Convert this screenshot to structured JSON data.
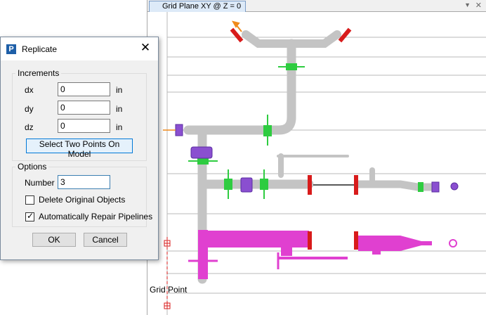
{
  "model_window": {
    "tab_title": "Grid Plane XY @ Z = 0",
    "grid_point_label": "Grid Point",
    "colors": {
      "pipe_gray": "#c8c8c8",
      "pipe_selected": "#e040d0",
      "flange_red": "#d81b1b",
      "support_green": "#2ecc40",
      "valve_purple": "#8a4fd0",
      "grid_line": "#b8b8b8"
    }
  },
  "dialog": {
    "title": "Replicate",
    "increments": {
      "legend": "Increments",
      "dx_label": "dx",
      "dx_value": "0",
      "dx_unit": "in",
      "dy_label": "dy",
      "dy_value": "0",
      "dy_unit": "in",
      "dz_label": "dz",
      "dz_value": "0",
      "dz_unit": "in",
      "select_points_label": "Select Two Points On Model"
    },
    "options": {
      "legend": "Options",
      "number_label": "Number",
      "number_value": "3",
      "delete_original_label": "Delete Original Objects",
      "delete_original_checked": false,
      "auto_repair_label": "Automatically Repair Pipelines",
      "auto_repair_checked": true
    },
    "ok_label": "OK",
    "cancel_label": "Cancel"
  }
}
